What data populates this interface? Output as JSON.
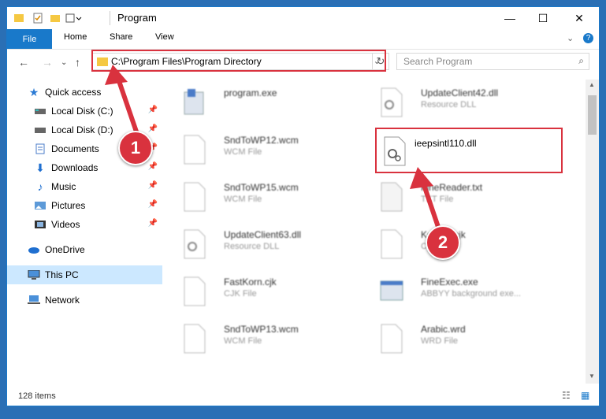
{
  "window": {
    "title": "Program",
    "minimize": "—",
    "maximize": "☐",
    "close": "✕"
  },
  "ribbon": {
    "file": "File",
    "tabs": [
      "Home",
      "Share",
      "View"
    ]
  },
  "address": {
    "path": "C:\\Program Files\\Program Directory",
    "search_placeholder": "Search Program"
  },
  "nav": {
    "items": [
      {
        "label": "Quick access",
        "icon": "star-icon"
      },
      {
        "label": "Local Disk (C:)",
        "icon": "drive-icon",
        "pinned": true
      },
      {
        "label": "Local Disk (D:)",
        "icon": "drive-icon",
        "pinned": true
      },
      {
        "label": "Documents",
        "icon": "document-icon",
        "pinned": true
      },
      {
        "label": "Downloads",
        "icon": "download-icon",
        "pinned": true
      },
      {
        "label": "Music",
        "icon": "music-icon",
        "pinned": true
      },
      {
        "label": "Pictures",
        "icon": "picture-icon",
        "pinned": true
      },
      {
        "label": "Videos",
        "icon": "video-icon",
        "pinned": true
      },
      {
        "label": "OneDrive",
        "icon": "cloud-icon"
      },
      {
        "label": "This PC",
        "icon": "computer-icon",
        "selected": true
      },
      {
        "label": "Network",
        "icon": "network-icon"
      }
    ]
  },
  "files": {
    "left": [
      {
        "name": "program.exe",
        "type": ""
      },
      {
        "name": "SndToWP12.wcm",
        "type": "WCM File"
      },
      {
        "name": "SndToWP15.wcm",
        "type": "WCM File"
      },
      {
        "name": "UpdateClient63.dll",
        "type": "Resource DLL"
      },
      {
        "name": "FastKorn.cjk",
        "type": "CJK File"
      },
      {
        "name": "SndToWP13.wcm",
        "type": "WCM File"
      }
    ],
    "right": [
      {
        "name": "UpdateClient42.dll",
        "type": "Resource DLL"
      },
      {
        "name": "ieepsintl110.dll",
        "type": ""
      },
      {
        "name": "FineReader.txt",
        "type": "TXT File"
      },
      {
        "name": "Korean.cjk",
        "type": "CJK File"
      },
      {
        "name": "FineExec.exe",
        "type": "ABBYY background exe..."
      },
      {
        "name": "Arabic.wrd",
        "type": "WRD File"
      }
    ]
  },
  "status": {
    "item_count": "128 items"
  },
  "callouts": [
    "1",
    "2"
  ],
  "colors": {
    "accent": "#1979ca",
    "highlight": "#d9323e"
  }
}
